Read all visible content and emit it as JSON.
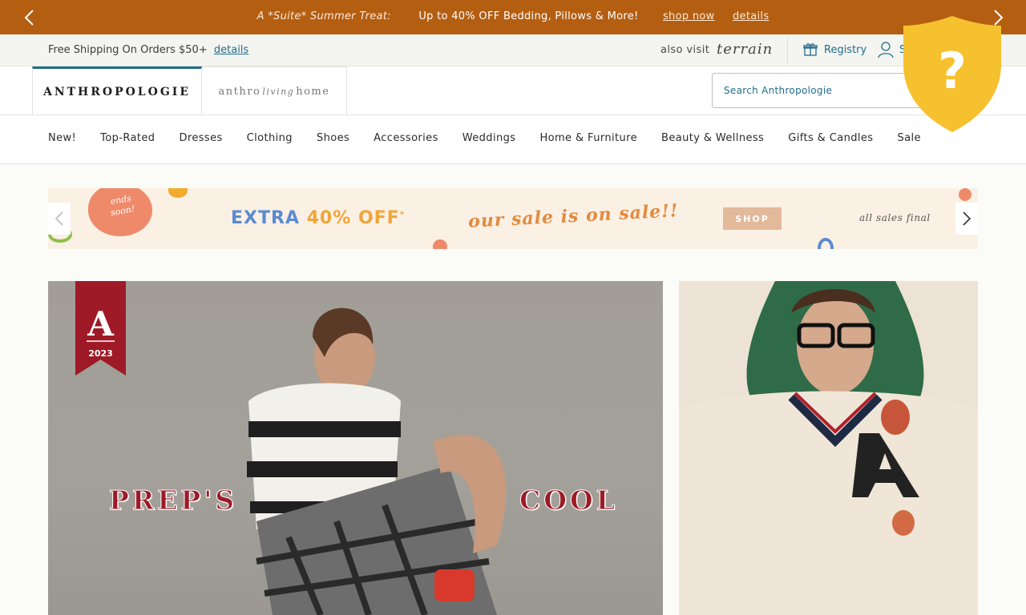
{
  "promo": {
    "lead": "A *Suite* Summer Treat:",
    "offer": "Up to 40% OFF Bedding, Pillows & More!",
    "shop_now": "shop now",
    "details": "details"
  },
  "utility": {
    "shipping": "Free Shipping On Orders $50+",
    "shipping_details": "details",
    "also_visit": "also visit",
    "terrain": "terrain",
    "registry": "Registry",
    "signin": "S"
  },
  "header": {
    "brand_main": "ANTHROPOLOGIE",
    "brand_home_left": "anthro",
    "brand_home_living": "living",
    "brand_home_right": "home",
    "search_placeholder": "Search Anthropologie"
  },
  "nav": {
    "items": [
      "New!",
      "Top-Rated",
      "Dresses",
      "Clothing",
      "Shoes",
      "Accessories",
      "Weddings",
      "Home & Furniture",
      "Beauty & Wellness",
      "Gifts & Candles",
      "Sale"
    ]
  },
  "banner": {
    "ends_soon": "ends soon!",
    "extra_prefix": "EXTRA ",
    "extra_pct": "40% OFF",
    "extra_mark": "*",
    "script": "our sale is on sale!!",
    "shop": "SHOP",
    "final": "all sales final"
  },
  "hero": {
    "ribbon_letter": "A",
    "ribbon_year": "2023",
    "word_left": "PREP'S",
    "word_right": "COOL"
  },
  "badge": {
    "symbol": "?"
  },
  "colors": {
    "promo_bg": "#b45e12",
    "accent": "#1f6e8c",
    "ribbon": "#9e1a26",
    "badge": "#f6c12e"
  }
}
